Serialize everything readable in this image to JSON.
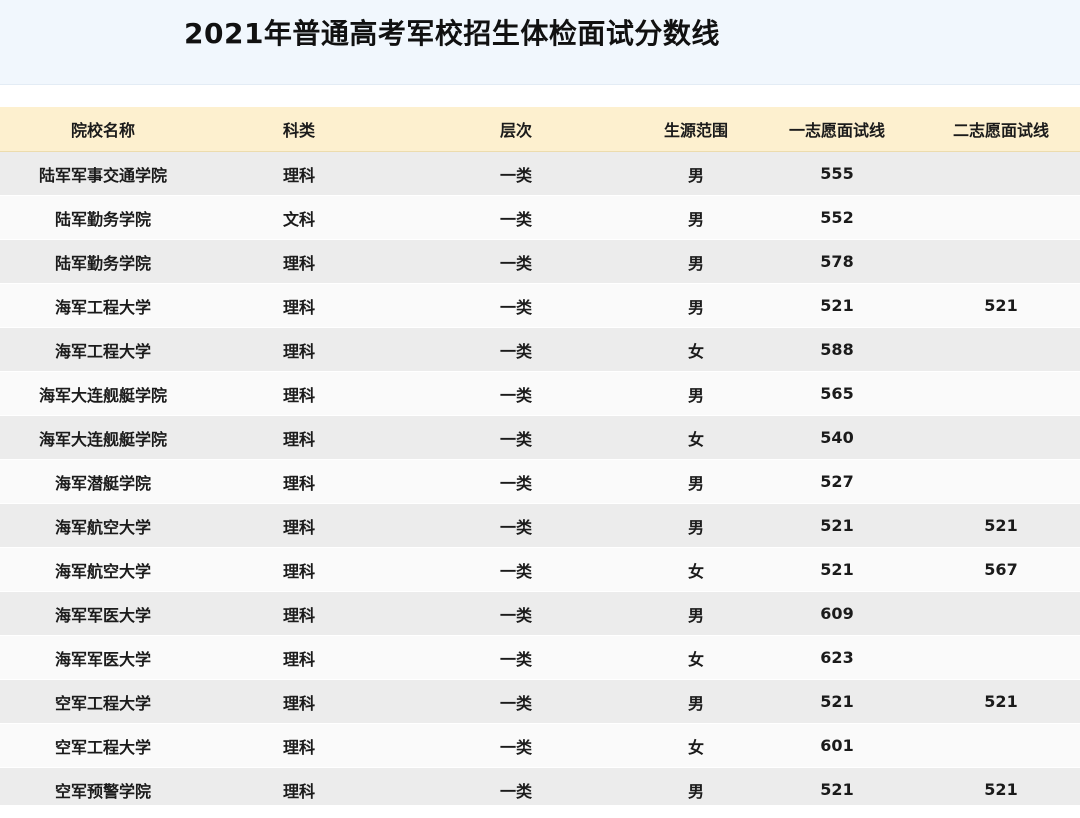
{
  "page": {
    "title": "2021年普通高考军校招生体检面试分数线"
  },
  "table": {
    "columns": [
      "院校名称",
      "科类",
      "层次",
      "生源范围",
      "一志愿面试线",
      "二志愿面试线"
    ],
    "rows": [
      [
        "陆军军事交通学院",
        "理科",
        "一类",
        "男",
        "555",
        ""
      ],
      [
        "陆军勤务学院",
        "文科",
        "一类",
        "男",
        "552",
        ""
      ],
      [
        "陆军勤务学院",
        "理科",
        "一类",
        "男",
        "578",
        ""
      ],
      [
        "海军工程大学",
        "理科",
        "一类",
        "男",
        "521",
        "521"
      ],
      [
        "海军工程大学",
        "理科",
        "一类",
        "女",
        "588",
        ""
      ],
      [
        "海军大连舰艇学院",
        "理科",
        "一类",
        "男",
        "565",
        ""
      ],
      [
        "海军大连舰艇学院",
        "理科",
        "一类",
        "女",
        "540",
        ""
      ],
      [
        "海军潜艇学院",
        "理科",
        "一类",
        "男",
        "527",
        ""
      ],
      [
        "海军航空大学",
        "理科",
        "一类",
        "男",
        "521",
        "521"
      ],
      [
        "海军航空大学",
        "理科",
        "一类",
        "女",
        "521",
        "567"
      ],
      [
        "海军军医大学",
        "理科",
        "一类",
        "男",
        "609",
        ""
      ],
      [
        "海军军医大学",
        "理科",
        "一类",
        "女",
        "623",
        ""
      ],
      [
        "空军工程大学",
        "理科",
        "一类",
        "男",
        "521",
        "521"
      ],
      [
        "空军工程大学",
        "理科",
        "一类",
        "女",
        "601",
        ""
      ],
      [
        "空军预警学院",
        "理科",
        "一类",
        "男",
        "521",
        "521"
      ]
    ]
  }
}
